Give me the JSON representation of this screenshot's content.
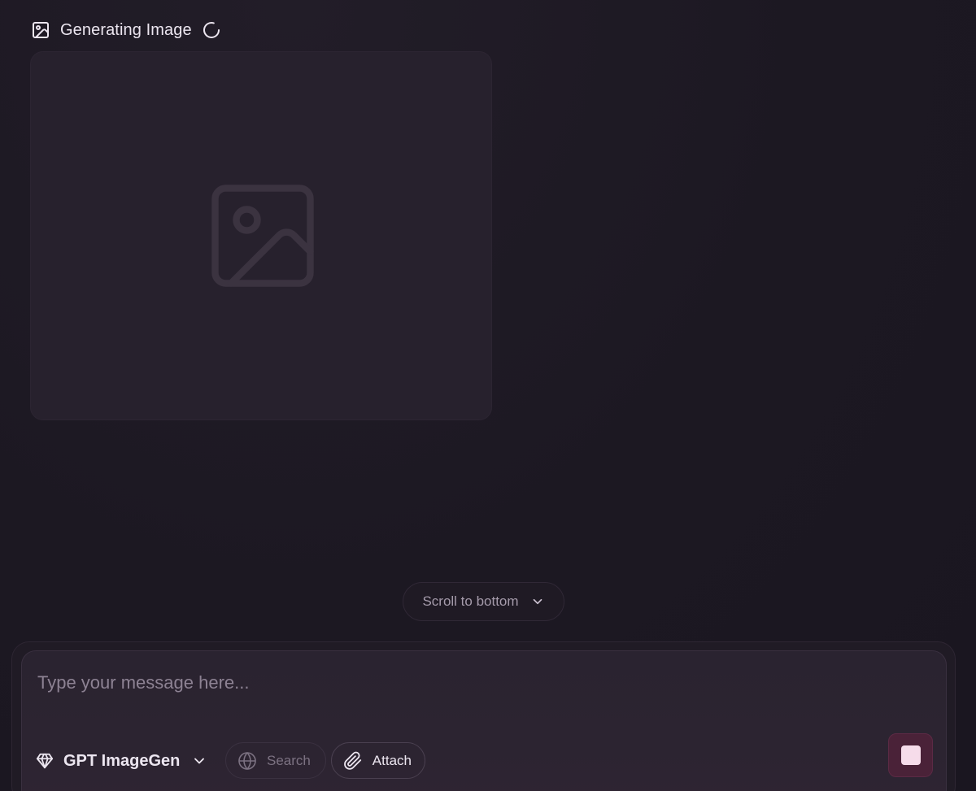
{
  "generation": {
    "status_label": "Generating Image",
    "header_icon": "image-icon",
    "spinner_icon": "loading-spinner-icon",
    "placeholder_icon": "image-placeholder-icon"
  },
  "scroll": {
    "label": "Scroll to bottom",
    "icon": "chevron-down-icon"
  },
  "composer": {
    "placeholder": "Type your message here...",
    "value": "",
    "model": {
      "label": "GPT ImageGen",
      "icon": "gem-icon",
      "dropdown_icon": "chevron-down-icon"
    },
    "search": {
      "label": "Search",
      "icon": "globe-icon"
    },
    "attach": {
      "label": "Attach",
      "icon": "paperclip-icon"
    },
    "stop": {
      "icon": "stop-icon"
    }
  },
  "colors": {
    "background": "#1c1822",
    "card": "#27212d",
    "stop_button": "#4a2238",
    "stop_square": "#f6dcea"
  }
}
